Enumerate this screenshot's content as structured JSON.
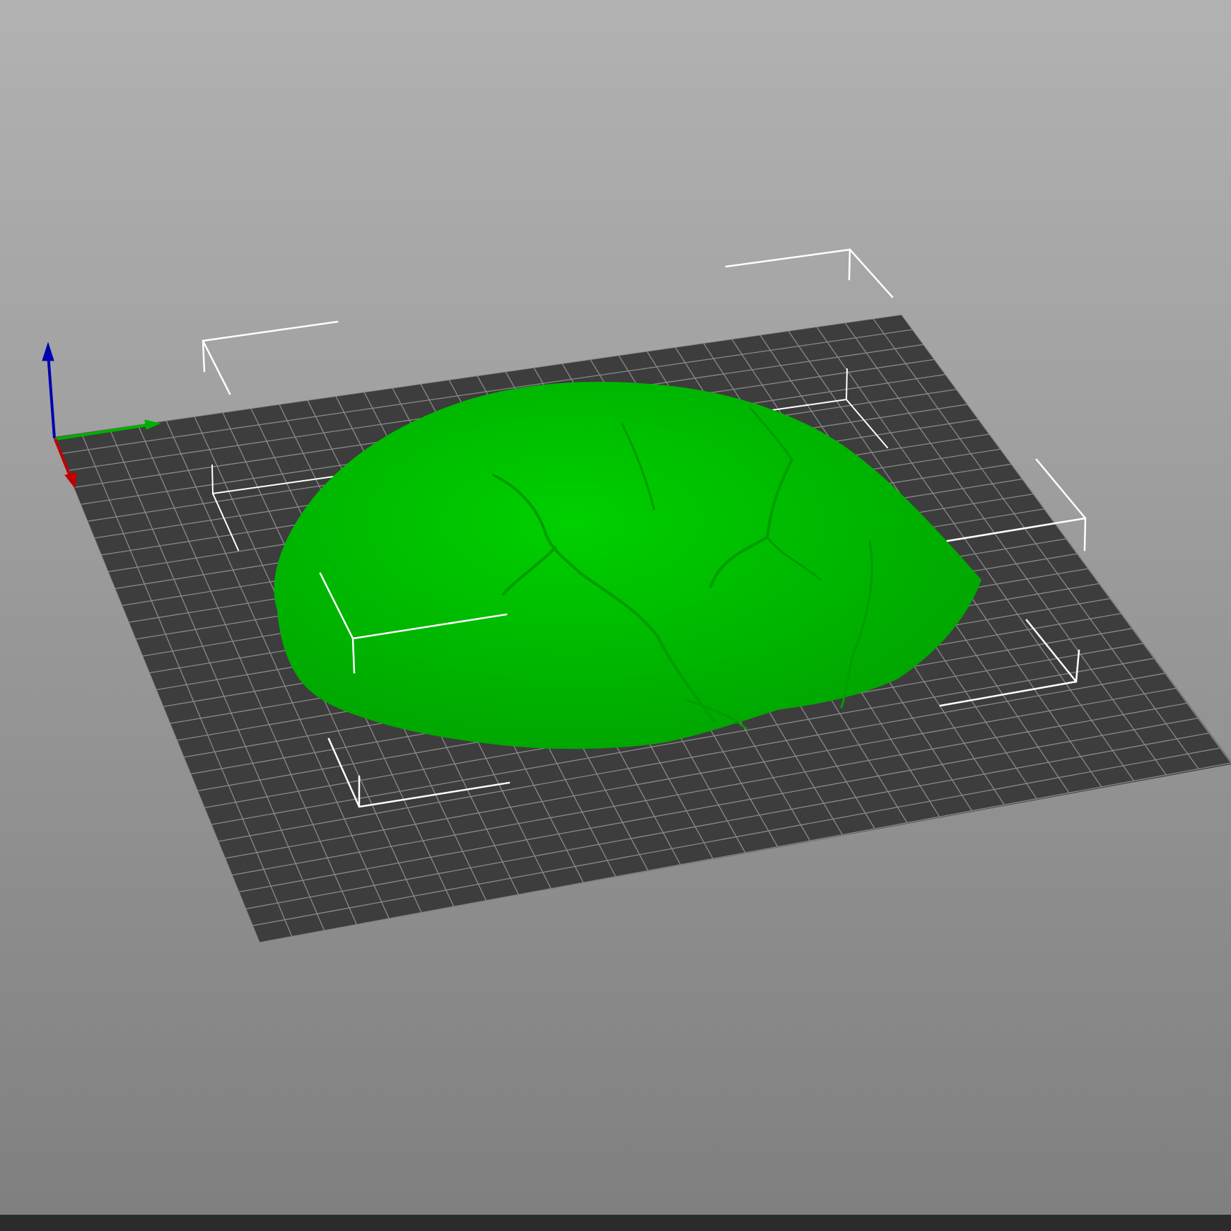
{
  "viewport": {
    "background_top_color": "#b2b2b2",
    "background_bottom_color": "#7f7f7f",
    "bed_color": "#3d3d3d",
    "bed_grid_color": "#8a8a8a",
    "model_color": "#00d000",
    "model_shade_color": "#009e00",
    "bounding_box_color": "#ffffff"
  },
  "axes": {
    "x_axis_color": "#c00000",
    "y_axis_color": "#00b000",
    "z_axis_color": "#0000b0"
  },
  "status_bar": {
    "color": "#2b2b2b"
  }
}
